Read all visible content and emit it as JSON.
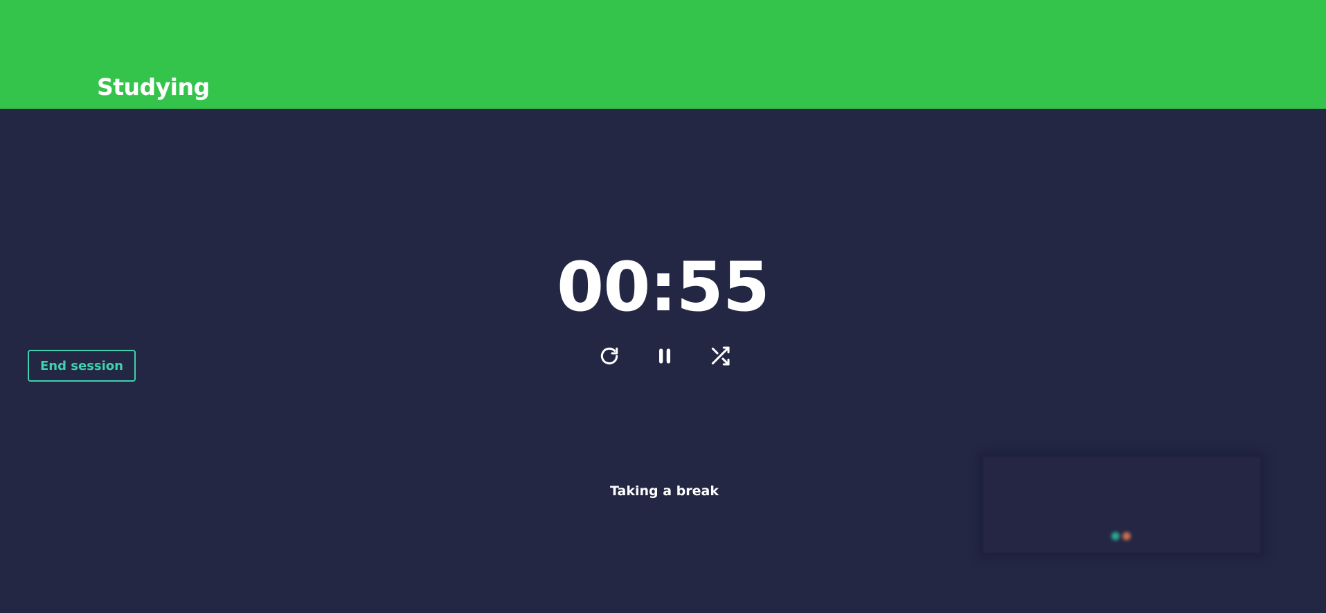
{
  "header": {
    "title": "Studying",
    "bg_color": "#34c44c"
  },
  "timer": {
    "display": "00:55"
  },
  "controls": {
    "restart_icon": "restart-icon",
    "pause_icon": "pause-icon",
    "shuffle_icon": "shuffle-icon"
  },
  "session": {
    "end_label": "End session",
    "accent_color": "#3fd1b0"
  },
  "status": {
    "text": "Taking a break"
  },
  "theme": {
    "background": "#232744",
    "text": "#ffffff"
  }
}
